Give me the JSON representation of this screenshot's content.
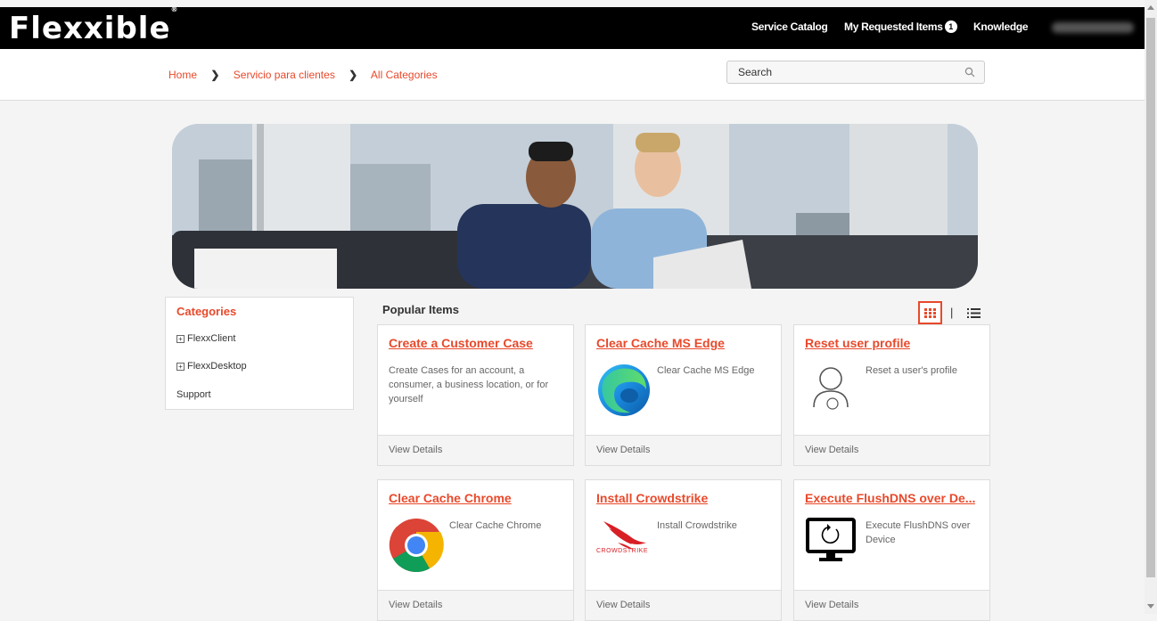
{
  "header": {
    "logo": "Flexxible",
    "logo_mark": "®",
    "nav": {
      "service_catalog": "Service Catalog",
      "my_requested_items": "My Requested Items",
      "requested_count": "1",
      "knowledge": "Knowledge"
    }
  },
  "breadcrumb": {
    "items": [
      "Home",
      "Servicio para clientes",
      "All Categories"
    ]
  },
  "search": {
    "placeholder": "Search"
  },
  "categories": {
    "title": "Categories",
    "items": [
      "FlexxClient",
      "FlexxDesktop",
      "Support"
    ]
  },
  "popular": {
    "title": "Popular Items",
    "cards": [
      {
        "title": "Create a Customer Case",
        "description": "Create Cases for an account, a consumer, a business location, or for yourself",
        "footer": "View Details",
        "icon": "none"
      },
      {
        "title": "Clear Cache MS Edge",
        "description": "Clear Cache MS Edge",
        "footer": "View Details",
        "icon": "edge-icon"
      },
      {
        "title": "Reset user profile",
        "description": "Reset a user's profile",
        "footer": "View Details",
        "icon": "user-profile-icon"
      },
      {
        "title": "Clear Cache Chrome",
        "description": "Clear Cache Chrome",
        "footer": "View Details",
        "icon": "chrome-icon"
      },
      {
        "title": "Install Crowdstrike",
        "description": "Install Crowdstrike",
        "footer": "View Details",
        "icon": "crowdstrike-icon",
        "icon_text": "CROWDSTRIKE"
      },
      {
        "title": "Execute FlushDNS over De...",
        "description": "Execute FlushDNS over Device",
        "footer": "View Details",
        "icon": "monitor-refresh-icon"
      }
    ]
  },
  "view_toggle": {
    "separator": "|"
  },
  "colors": {
    "accent": "#e8492b",
    "topbar": "#000000"
  }
}
